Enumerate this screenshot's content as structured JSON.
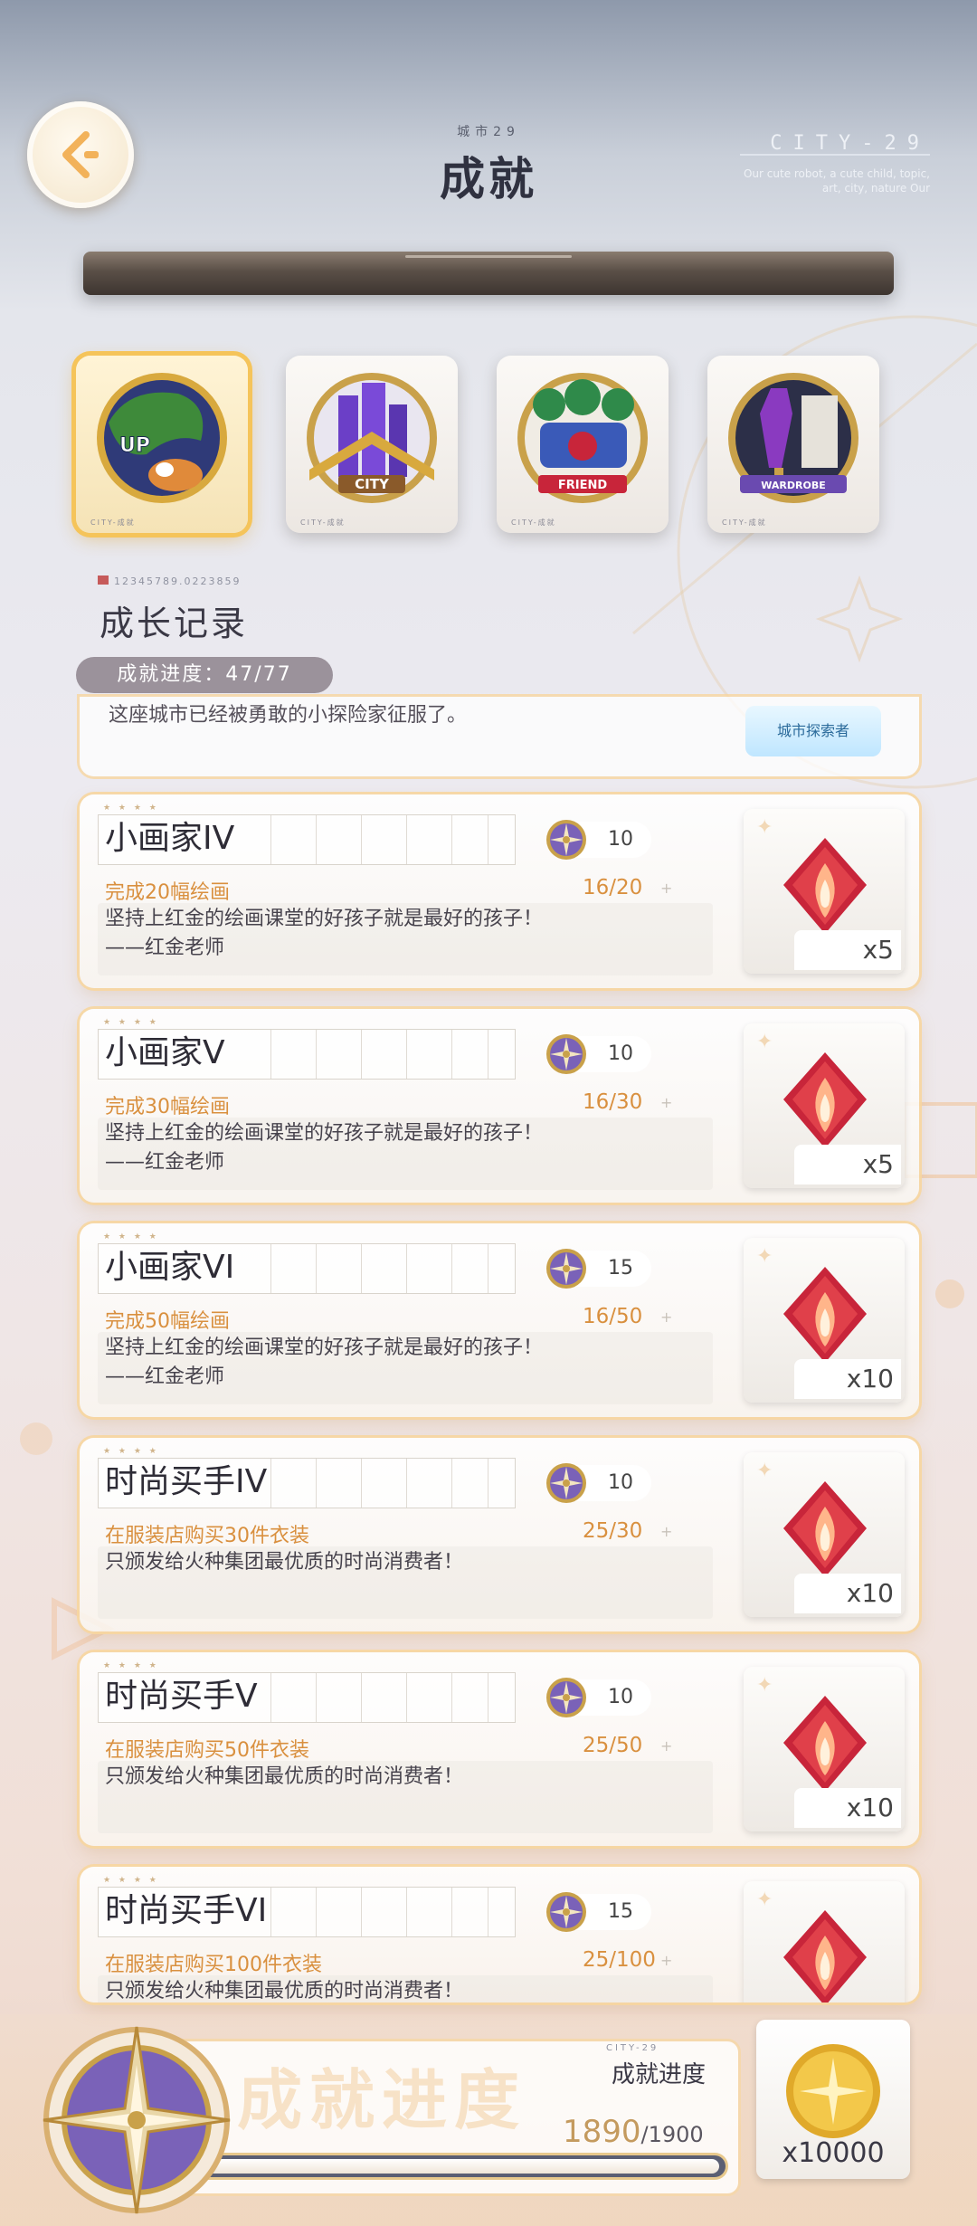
{
  "header": {
    "back_label": "back",
    "subtitle": "城市29",
    "title": "成就",
    "city_tag": "CITY-29",
    "city_desc": "Our cute robot, a cute child, topic, art, city, nature Our"
  },
  "categories": [
    {
      "label": "UP",
      "active": true,
      "footer": "CITY-成就"
    },
    {
      "label": "CITY",
      "active": false,
      "footer": "CITY-成就"
    },
    {
      "label": "FRIEND",
      "active": false,
      "footer": "CITY-成就"
    },
    {
      "label": "WARDROBE",
      "active": false,
      "footer": "CITY-成就"
    }
  ],
  "section": {
    "code": "12345789.0223859",
    "title": "成长记录",
    "progress_label": "成就进度：47/77"
  },
  "partial_card": {
    "desc": "这座城市已经被勇敢的小探险家征服了。",
    "badge_text": "城市探索者"
  },
  "cards": [
    {
      "name": "小画家IV",
      "points": "10",
      "task": "完成20幅绘画",
      "progress": "16/20",
      "desc": "坚持上红金的绘画课堂的好孩子就是最好的孩子！",
      "desc2": "——红金老师",
      "reward_qty": "x5"
    },
    {
      "name": "小画家Ⅴ",
      "points": "10",
      "task": "完成30幅绘画",
      "progress": "16/30",
      "desc": "坚持上红金的绘画课堂的好孩子就是最好的孩子！",
      "desc2": "——红金老师",
      "reward_qty": "x5"
    },
    {
      "name": "小画家VI",
      "points": "15",
      "task": "完成50幅绘画",
      "progress": "16/50",
      "desc": "坚持上红金的绘画课堂的好孩子就是最好的孩子！",
      "desc2": "——红金老师",
      "reward_qty": "x10"
    },
    {
      "name": "时尚买手IV",
      "points": "10",
      "task": "在服装店购买30件衣装",
      "progress": "25/30",
      "desc": "只颁发给火种集团最优质的时尚消费者！",
      "desc2": "",
      "reward_qty": "x10"
    },
    {
      "name": "时尚买手Ⅴ",
      "points": "10",
      "task": "在服装店购买50件衣装",
      "progress": "25/50",
      "desc": "只颁发给火种集团最优质的时尚消费者！",
      "desc2": "",
      "reward_qty": "x10"
    },
    {
      "name": "时尚买手VI",
      "points": "15",
      "task": "在服装店购买100件衣装",
      "progress": "25/100",
      "desc": "只颁发给火种集团最优质的时尚消费者！",
      "desc2": "",
      "reward_qty": ""
    }
  ],
  "bottom": {
    "watermark": "成就进度",
    "tag": "CITY-29",
    "label": "成就进度",
    "current": "1890",
    "total": "/1900",
    "fraction": 0.995,
    "reward_qty": "x10000"
  },
  "colors": {
    "accent_orange": "#d9903f",
    "gold": "#f5c45a",
    "gem_red": "#c8253a",
    "medal_purple": "#6e59a8"
  }
}
